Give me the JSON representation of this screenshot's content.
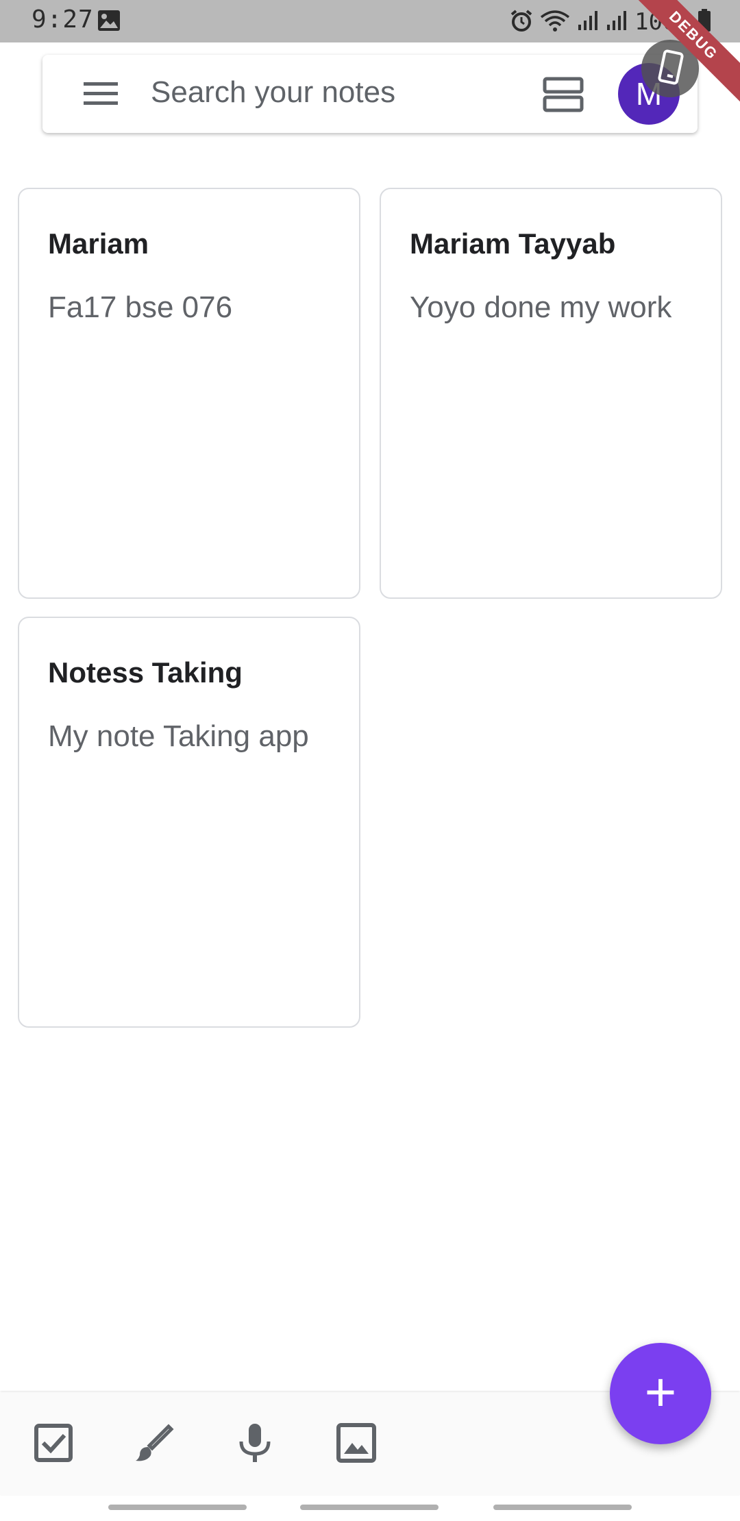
{
  "status_bar": {
    "time": "9:27",
    "battery_text": "100%"
  },
  "debug_banner": "DEBUG",
  "search": {
    "placeholder": "Search your notes"
  },
  "avatar": {
    "initial": "M"
  },
  "notes": [
    {
      "title": "Mariam",
      "body": "Fa17 bse 076"
    },
    {
      "title": "Mariam Tayyab",
      "body": "Yoyo done my work"
    },
    {
      "title": "Notess Taking",
      "body": "My note Taking app"
    }
  ],
  "fab": {
    "label": "+"
  },
  "bottom_bar": {
    "icons": [
      "checkbox-icon",
      "brush-icon",
      "mic-icon",
      "image-icon"
    ]
  },
  "colors": {
    "accent": "#7b3ff0",
    "avatar": "#5327b9",
    "status_bar": "#b9b9b9",
    "debug": "#b4444c"
  }
}
